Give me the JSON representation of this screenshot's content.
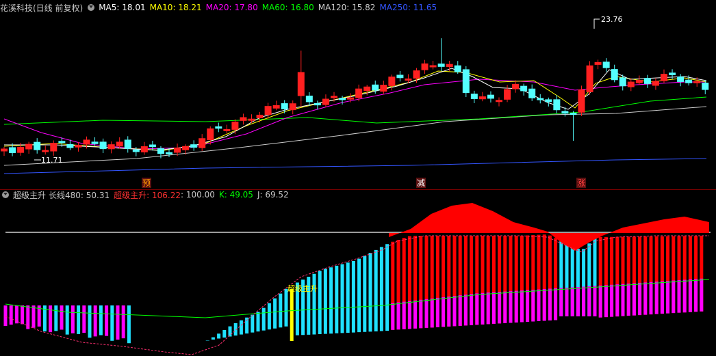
{
  "main": {
    "stock_title": "花溪科技(日线 前复权)",
    "ma_labels": [
      {
        "text": "MA5: 18.01",
        "color": "#ffffff"
      },
      {
        "text": "MA10: 18.21",
        "color": "#ffff00"
      },
      {
        "text": "MA20: 17.80",
        "color": "#ff00ff"
      },
      {
        "text": "MA60: 16.80",
        "color": "#00ff00"
      },
      {
        "text": "MA120: 15.82",
        "color": "#cccccc"
      },
      {
        "text": "MA250: 11.65",
        "color": "#3355ff"
      }
    ],
    "high_label": "23.76",
    "low_label": "11.71",
    "markers": [
      {
        "text": "预",
        "color": "#ff9900",
        "bg": "#5a1010"
      },
      {
        "text": "减",
        "color": "#ffffff",
        "bg": "#5a1010"
      },
      {
        "text": "涨",
        "color": "#ff4040",
        "bg": "#5a1010"
      }
    ],
    "colors": {
      "up": "#ff2020",
      "down": "#54ffff",
      "background": "#000000"
    }
  },
  "indicator": {
    "name": "超级主升",
    "long_line": "长线480: 50.31",
    "super_main": "超级主升: 106.22",
    "ref_line": ": 100.00",
    "k": "K: 49.05",
    "j": "J: 69.52",
    "signal_label": "超级主升",
    "colors": {
      "magenta": "#ff00ff",
      "cyan": "#20e0ff",
      "red": "#ff0000",
      "yellow": "#ffff00",
      "green": "#00ff00"
    }
  }
}
